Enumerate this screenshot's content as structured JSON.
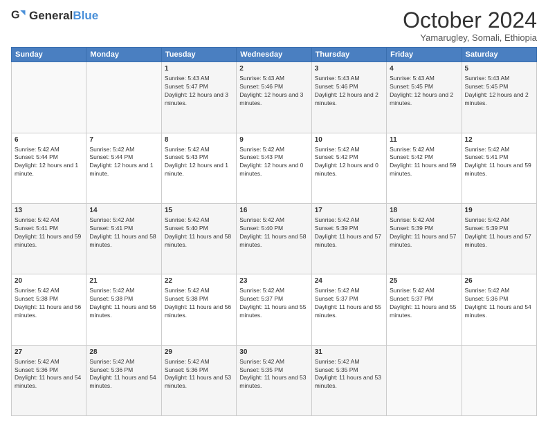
{
  "logo": {
    "text1": "General",
    "text2": "Blue"
  },
  "title": "October 2024",
  "subtitle": "Yamarugley, Somali, Ethiopia",
  "days_of_week": [
    "Sunday",
    "Monday",
    "Tuesday",
    "Wednesday",
    "Thursday",
    "Friday",
    "Saturday"
  ],
  "weeks": [
    [
      {
        "day": "",
        "info": ""
      },
      {
        "day": "",
        "info": ""
      },
      {
        "day": "1",
        "info": "Sunrise: 5:43 AM\nSunset: 5:47 PM\nDaylight: 12 hours and 3 minutes."
      },
      {
        "day": "2",
        "info": "Sunrise: 5:43 AM\nSunset: 5:46 PM\nDaylight: 12 hours and 3 minutes."
      },
      {
        "day": "3",
        "info": "Sunrise: 5:43 AM\nSunset: 5:46 PM\nDaylight: 12 hours and 2 minutes."
      },
      {
        "day": "4",
        "info": "Sunrise: 5:43 AM\nSunset: 5:45 PM\nDaylight: 12 hours and 2 minutes."
      },
      {
        "day": "5",
        "info": "Sunrise: 5:43 AM\nSunset: 5:45 PM\nDaylight: 12 hours and 2 minutes."
      }
    ],
    [
      {
        "day": "6",
        "info": "Sunrise: 5:42 AM\nSunset: 5:44 PM\nDaylight: 12 hours and 1 minute."
      },
      {
        "day": "7",
        "info": "Sunrise: 5:42 AM\nSunset: 5:44 PM\nDaylight: 12 hours and 1 minute."
      },
      {
        "day": "8",
        "info": "Sunrise: 5:42 AM\nSunset: 5:43 PM\nDaylight: 12 hours and 1 minute."
      },
      {
        "day": "9",
        "info": "Sunrise: 5:42 AM\nSunset: 5:43 PM\nDaylight: 12 hours and 0 minutes."
      },
      {
        "day": "10",
        "info": "Sunrise: 5:42 AM\nSunset: 5:42 PM\nDaylight: 12 hours and 0 minutes."
      },
      {
        "day": "11",
        "info": "Sunrise: 5:42 AM\nSunset: 5:42 PM\nDaylight: 11 hours and 59 minutes."
      },
      {
        "day": "12",
        "info": "Sunrise: 5:42 AM\nSunset: 5:41 PM\nDaylight: 11 hours and 59 minutes."
      }
    ],
    [
      {
        "day": "13",
        "info": "Sunrise: 5:42 AM\nSunset: 5:41 PM\nDaylight: 11 hours and 59 minutes."
      },
      {
        "day": "14",
        "info": "Sunrise: 5:42 AM\nSunset: 5:41 PM\nDaylight: 11 hours and 58 minutes."
      },
      {
        "day": "15",
        "info": "Sunrise: 5:42 AM\nSunset: 5:40 PM\nDaylight: 11 hours and 58 minutes."
      },
      {
        "day": "16",
        "info": "Sunrise: 5:42 AM\nSunset: 5:40 PM\nDaylight: 11 hours and 58 minutes."
      },
      {
        "day": "17",
        "info": "Sunrise: 5:42 AM\nSunset: 5:39 PM\nDaylight: 11 hours and 57 minutes."
      },
      {
        "day": "18",
        "info": "Sunrise: 5:42 AM\nSunset: 5:39 PM\nDaylight: 11 hours and 57 minutes."
      },
      {
        "day": "19",
        "info": "Sunrise: 5:42 AM\nSunset: 5:39 PM\nDaylight: 11 hours and 57 minutes."
      }
    ],
    [
      {
        "day": "20",
        "info": "Sunrise: 5:42 AM\nSunset: 5:38 PM\nDaylight: 11 hours and 56 minutes."
      },
      {
        "day": "21",
        "info": "Sunrise: 5:42 AM\nSunset: 5:38 PM\nDaylight: 11 hours and 56 minutes."
      },
      {
        "day": "22",
        "info": "Sunrise: 5:42 AM\nSunset: 5:38 PM\nDaylight: 11 hours and 56 minutes."
      },
      {
        "day": "23",
        "info": "Sunrise: 5:42 AM\nSunset: 5:37 PM\nDaylight: 11 hours and 55 minutes."
      },
      {
        "day": "24",
        "info": "Sunrise: 5:42 AM\nSunset: 5:37 PM\nDaylight: 11 hours and 55 minutes."
      },
      {
        "day": "25",
        "info": "Sunrise: 5:42 AM\nSunset: 5:37 PM\nDaylight: 11 hours and 55 minutes."
      },
      {
        "day": "26",
        "info": "Sunrise: 5:42 AM\nSunset: 5:36 PM\nDaylight: 11 hours and 54 minutes."
      }
    ],
    [
      {
        "day": "27",
        "info": "Sunrise: 5:42 AM\nSunset: 5:36 PM\nDaylight: 11 hours and 54 minutes."
      },
      {
        "day": "28",
        "info": "Sunrise: 5:42 AM\nSunset: 5:36 PM\nDaylight: 11 hours and 54 minutes."
      },
      {
        "day": "29",
        "info": "Sunrise: 5:42 AM\nSunset: 5:36 PM\nDaylight: 11 hours and 53 minutes."
      },
      {
        "day": "30",
        "info": "Sunrise: 5:42 AM\nSunset: 5:35 PM\nDaylight: 11 hours and 53 minutes."
      },
      {
        "day": "31",
        "info": "Sunrise: 5:42 AM\nSunset: 5:35 PM\nDaylight: 11 hours and 53 minutes."
      },
      {
        "day": "",
        "info": ""
      },
      {
        "day": "",
        "info": ""
      }
    ]
  ]
}
